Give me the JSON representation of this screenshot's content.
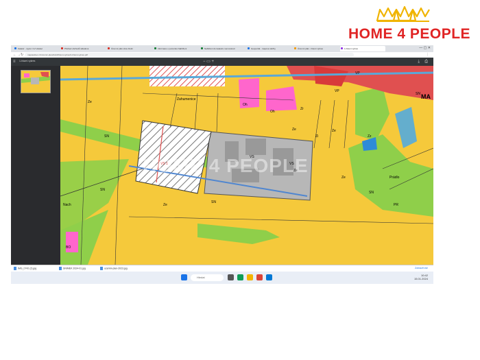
{
  "logo": {
    "text": "HOME 4 PEOPLE"
  },
  "browser": {
    "tabs": [
      {
        "label": "Katastr - výpis z LV Hradec",
        "fav": "#1a73e8"
      },
      {
        "label": "Přehled obchodů skladové",
        "fav": "#d93025"
      },
      {
        "label": "Územní plán obce Dolní",
        "fav": "#d93025"
      },
      {
        "label": "Informace o pozemku Nahlížení",
        "fav": "#188038"
      },
      {
        "label": "Nahlížení do katastru nemovitostí",
        "fav": "#188038"
      },
      {
        "label": "Geoportál - mapové služby",
        "fav": "#1a73e8"
      },
      {
        "label": "Územní plán - hlavní výkres",
        "fav": "#f29900"
      },
      {
        "label": "1-hlavni vykres",
        "fav": "#9334e6"
      }
    ],
    "url": "mapasobec.cz/uzemni-plan/dolni/hlavni-vykres/1-hlavni-vykres.pdf",
    "pdf_name": "1-hlavni vykres"
  },
  "map": {
    "labels": [
      "Ze",
      "Ze",
      "Ze",
      "Ze",
      "Zr",
      "Ze",
      "Zz",
      "VP",
      "SN",
      "SN",
      "SN",
      "SN",
      "VS",
      "VS",
      "PR",
      "Prádlo",
      "Oh",
      "Oh",
      "VP",
      "SN",
      "Zahumenice",
      "Nach",
      "BO",
      "VS 1",
      "MA",
      "Zi",
      "Ze"
    ],
    "watermark": "HOME 4 PEOPLE"
  },
  "downloads": {
    "items": [
      "IMG_0742 (2).jpg",
      "SNIMEK 2024-01.jpg",
      "uzemni-plan-2023.jpg"
    ],
    "show_all": "Zobrazit vše"
  },
  "taskbar": {
    "search_placeholder": "Hledat",
    "time": "10:42",
    "date": "15.01.2024"
  },
  "colors": {
    "brand": "#e02424",
    "zone_yellow": "#f5c93b",
    "zone_green": "#8fcf4a",
    "zone_grey": "#b7b7b7",
    "zone_pink": "#ff66cc",
    "zone_red": "#e05050"
  }
}
